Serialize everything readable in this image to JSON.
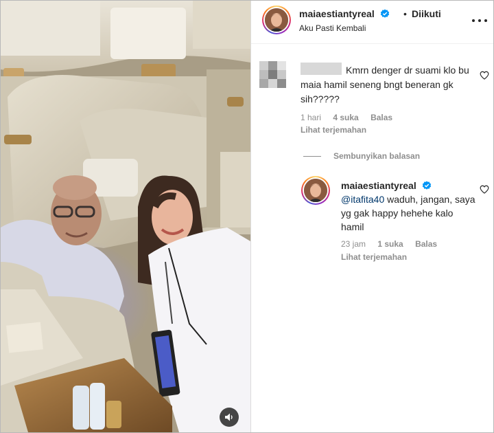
{
  "post": {
    "username": "maiaestiantyreal",
    "separator": "•",
    "follow_label": "Diikuti",
    "subtitle": "Aku Pasti Kembali"
  },
  "comment": {
    "text": "Kmrn denger dr suami klo bu maia hamil seneng bngt beneran gk sih?????",
    "time": "1 hari",
    "likes": "4 suka",
    "reply_label": "Balas",
    "translate_label": "Lihat terjemahan"
  },
  "hide_replies_label": "Sembunyikan balasan",
  "reply": {
    "username": "maiaestiantyreal",
    "mention": "@itafita40",
    "text": "waduh, jangan, saya yg gak happy hehehe kalo hamil",
    "time": "23 jam",
    "likes": "1 suka",
    "reply_label": "Balas",
    "translate_label": "Lihat terjemahan"
  },
  "icons": {
    "verified": "verified-badge-icon",
    "more": "more-options-icon",
    "heart": "heart-outline-icon",
    "sound": "speaker-icon"
  },
  "colors": {
    "verified_blue": "#0095f6",
    "meta_gray": "#8e8e8e",
    "mention_blue": "#00376b"
  }
}
